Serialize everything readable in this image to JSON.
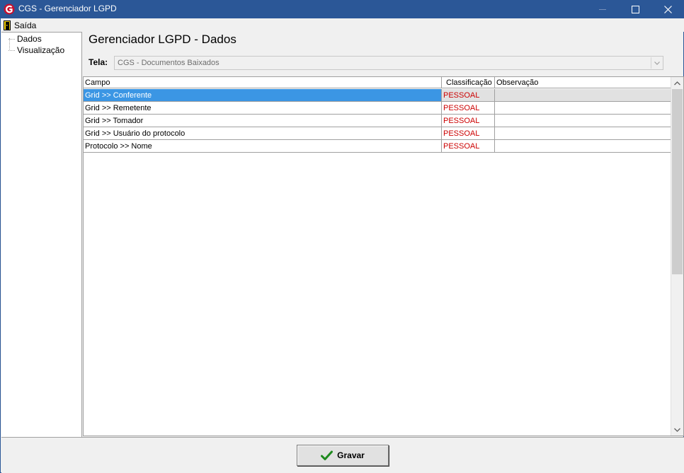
{
  "window": {
    "title": "CGS - Gerenciador LGPD",
    "accent_color": "#2b5797"
  },
  "menu": {
    "items": [
      {
        "label": "Saída",
        "icon": "exit-door-icon"
      }
    ]
  },
  "sidebar": {
    "items": [
      {
        "label": "Dados"
      },
      {
        "label": "Visualização"
      }
    ]
  },
  "main": {
    "title": "Gerenciador LGPD - Dados",
    "tela_label": "Tela:",
    "tela_value": "CGS - Documentos Baixados"
  },
  "grid": {
    "columns": [
      "Campo",
      "Classificação",
      "Observação"
    ],
    "rows": [
      {
        "campo": "Grid >> Conferente",
        "classificacao": "PESSOAL",
        "observacao": "",
        "selected": true
      },
      {
        "campo": "Grid >> Remetente",
        "classificacao": "PESSOAL",
        "observacao": ""
      },
      {
        "campo": "Grid >> Tomador",
        "classificacao": "PESSOAL",
        "observacao": ""
      },
      {
        "campo": "Grid >> Usuário do protocolo",
        "classificacao": "PESSOAL",
        "observacao": ""
      },
      {
        "campo": "Protocolo >> Nome",
        "classificacao": "PESSOAL",
        "observacao": ""
      }
    ],
    "classification_color": "#cc0000",
    "selection_color": "#3b96e4"
  },
  "footer": {
    "save_label": "Gravar",
    "save_icon": "checkmark-icon"
  }
}
